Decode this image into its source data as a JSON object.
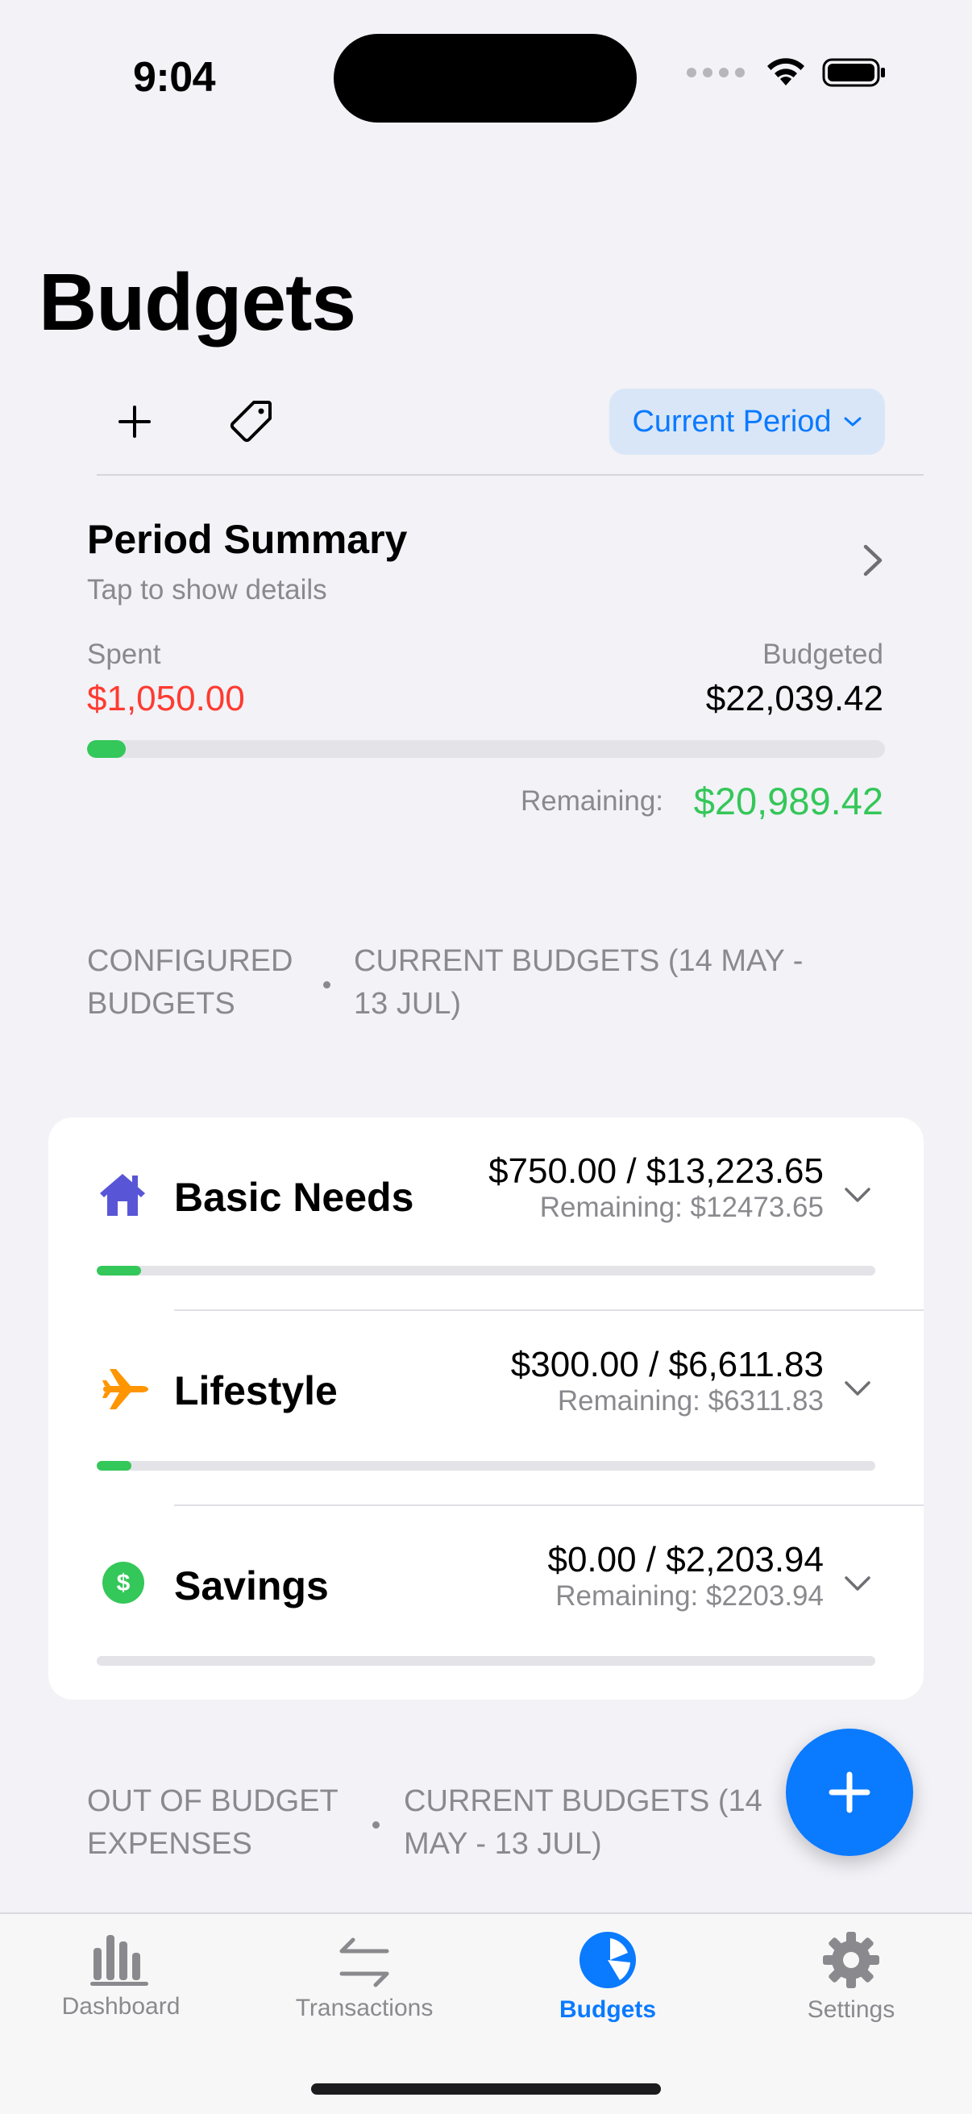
{
  "status_bar": {
    "time": "9:04"
  },
  "header": {
    "title": "Budgets",
    "period_button": "Current Period"
  },
  "summary": {
    "title": "Period Summary",
    "subtitle": "Tap to show details",
    "spent_label": "Spent",
    "spent_value": "$1,050.00",
    "budgeted_label": "Budgeted",
    "budgeted_value": "$22,039.42",
    "progress": 0.048,
    "remaining_label": "Remaining:",
    "remaining_value": "$20,989.42"
  },
  "section_configured": {
    "left_line1": "CONFIGURED",
    "left_line2": "BUDGETS",
    "right_line1": "CURRENT BUDGETS (14 MAY -",
    "right_line2": "13 JUL)"
  },
  "budgets": [
    {
      "name": "Basic Needs",
      "amount": "$750.00 / $13,223.65",
      "remaining": "Remaining: $12473.65",
      "progress": 0.057,
      "icon": "house-icon",
      "color": "#5856d6"
    },
    {
      "name": "Lifestyle",
      "amount": "$300.00 / $6,611.83",
      "remaining": "Remaining: $6311.83",
      "progress": 0.045,
      "icon": "airplane-icon",
      "color": "#ff9500"
    },
    {
      "name": "Savings",
      "amount": "$0.00 / $2,203.94",
      "remaining": "Remaining: $2203.94",
      "progress": 0.0,
      "icon": "dollar-circle-icon",
      "color": "#34c759"
    }
  ],
  "section_out": {
    "left_line1": "OUT OF BUDGET",
    "left_line2": "EXPENSES",
    "right_line1": "CURRENT BUDGETS (14",
    "right_line2": "MAY - 13 JUL)"
  },
  "tabs": [
    {
      "label": "Dashboard",
      "icon": "bar-chart-icon",
      "active": false
    },
    {
      "label": "Transactions",
      "icon": "arrows-exchange-icon",
      "active": false
    },
    {
      "label": "Budgets",
      "icon": "pie-chart-icon",
      "active": true
    },
    {
      "label": "Settings",
      "icon": "gear-icon",
      "active": false
    }
  ]
}
